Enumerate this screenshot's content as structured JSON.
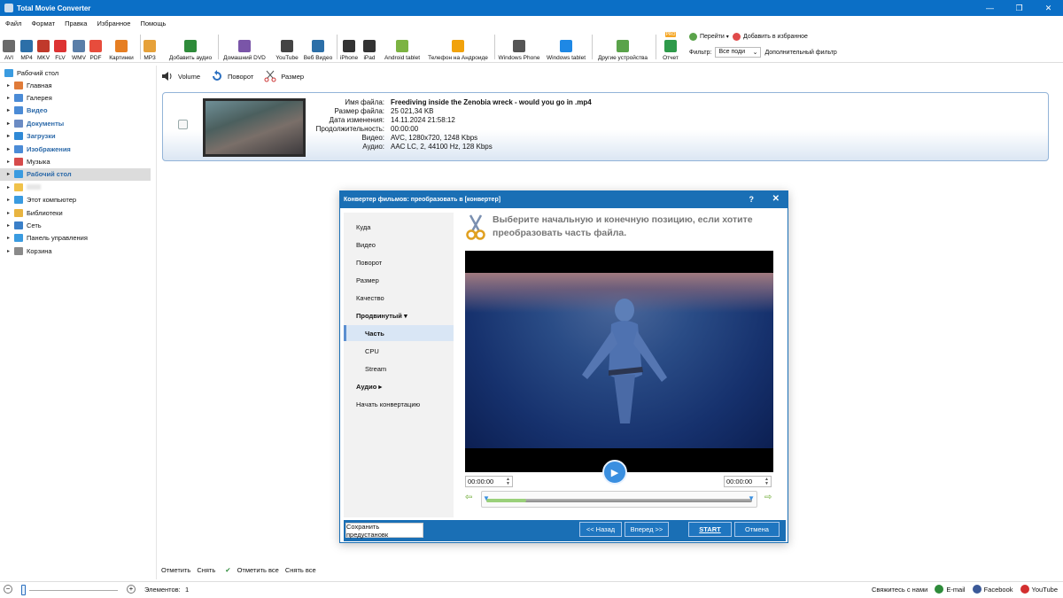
{
  "window": {
    "title": "Total Movie Converter",
    "min": "—",
    "max": "❐",
    "close": "✕"
  },
  "menu": [
    "Файл",
    "Формат",
    "Правка",
    "Избранное",
    "Помощь"
  ],
  "toolbar": {
    "items": [
      {
        "label": "AVI",
        "icon": "avi-icon",
        "color": "#6a6a6a"
      },
      {
        "label": "MP4",
        "icon": "mp4-icon",
        "color": "#2c6fa8"
      },
      {
        "label": "MKV",
        "icon": "mkv-icon",
        "color": "#c0392b"
      },
      {
        "label": "FLV",
        "icon": "flv-icon",
        "color": "#d33"
      },
      {
        "label": "WMV",
        "icon": "wmv-icon",
        "color": "#5a7ea8"
      },
      {
        "label": "PDF",
        "icon": "pdf-icon",
        "color": "#e74c3c"
      },
      {
        "label": "Картинки",
        "icon": "images-icon",
        "color": "#e67e22"
      },
      {
        "label": "MP3",
        "icon": "mp3-icon",
        "color": "#e6a13a"
      },
      {
        "label": "Добавить аудио",
        "icon": "add-audio-icon",
        "color": "#2e8b3a"
      },
      {
        "label": "Домашний DVD",
        "icon": "dvd-icon",
        "color": "#7a55a8"
      },
      {
        "label": "YouTube",
        "icon": "youtube-icon",
        "color": "#444"
      },
      {
        "label": "Веб Видео",
        "icon": "web-video-icon",
        "color": "#2c6fa8"
      },
      {
        "label": "iPhone",
        "icon": "iphone-icon",
        "color": "#333"
      },
      {
        "label": "iPad",
        "icon": "ipad-icon",
        "color": "#333"
      },
      {
        "label": "Android tablet",
        "icon": "android-tablet-icon",
        "color": "#7cb342"
      },
      {
        "label": "Телефон на Андроиде",
        "icon": "android-phone-icon",
        "color": "#f1a20b"
      },
      {
        "label": "Windows Phone",
        "icon": "windows-phone-icon",
        "color": "#555"
      },
      {
        "label": "Windows tablet",
        "icon": "windows-tablet-icon",
        "color": "#1e88e5"
      },
      {
        "label": "Другие устройства",
        "icon": "other-devices-icon",
        "color": "#5aa34a"
      },
      {
        "label": "Отчет",
        "icon": "report-icon",
        "color": "#2e9a4a",
        "badge": "PRO"
      }
    ],
    "goto_label": "Перейти",
    "add_fav_label": "Добавить в избранное",
    "filter_label": "Фильтр:",
    "filter_value": "Все поди",
    "advanced_filter_label": "Дополнительный фильтр"
  },
  "sidebar": {
    "root": "Рабочий стол",
    "items": [
      {
        "label": "Главная",
        "bold": false,
        "color": "#e07b39"
      },
      {
        "label": "Галерея",
        "bold": false,
        "color": "#4b8bd6"
      },
      {
        "label": "Видео",
        "bold": true,
        "color": "#4b8bd6"
      },
      {
        "label": "Документы",
        "bold": true,
        "color": "#6c8cc4"
      },
      {
        "label": "Загрузки",
        "bold": true,
        "color": "#2f89d6"
      },
      {
        "label": "Изображения",
        "bold": true,
        "color": "#4b8bd6"
      },
      {
        "label": "Музыка",
        "bold": false,
        "color": "#d64b4b"
      },
      {
        "label": "Рабочий стол",
        "bold": true,
        "selected": true,
        "color": "#3a9be0"
      },
      {
        "label": "",
        "bold": false,
        "color": "#f0c24a"
      },
      {
        "label": "Этот компьютер",
        "bold": false,
        "color": "#3a9be0"
      },
      {
        "label": "Библиотеки",
        "bold": false,
        "color": "#e8b440"
      },
      {
        "label": "Сеть",
        "bold": false,
        "color": "#3a7fc8"
      },
      {
        "label": "Панель управления",
        "bold": false,
        "color": "#3a9be0"
      },
      {
        "label": "Корзина",
        "bold": false,
        "color": "#8a8a8a"
      }
    ]
  },
  "actions": {
    "volume": "Volume",
    "rotate": "Поворот",
    "resize": "Размер"
  },
  "file": {
    "labels": {
      "name": "Имя файла:",
      "size": "Размер файла:",
      "modified": "Дата изменения:",
      "duration": "Продолжительность:",
      "video": "Видео:",
      "audio": "Аудио:"
    },
    "name": "Freediving inside the Zenobia wreck - would you go in  .mp4",
    "size": "25 021,34 KB",
    "modified": "14.11.2024 21:58:12",
    "duration": "00:00:00",
    "video": "AVC, 1280x720, 1248 Kbps",
    "audio": "AAC LC, 2, 44100 Hz, 128 Kbps"
  },
  "dialog": {
    "title": "Конвертер фильмов: преобразовать в [конвертер]",
    "help": "?",
    "close": "✕",
    "nav": [
      {
        "label": "Куда",
        "type": "normal"
      },
      {
        "label": "Видео",
        "type": "normal"
      },
      {
        "label": "Поворот",
        "type": "normal"
      },
      {
        "label": "Размер",
        "type": "normal"
      },
      {
        "label": "Качество",
        "type": "normal"
      },
      {
        "label": "Продвинутый ▾",
        "type": "bold"
      },
      {
        "label": "Часть",
        "type": "active"
      },
      {
        "label": "CPU",
        "type": "sub"
      },
      {
        "label": "Stream",
        "type": "sub"
      },
      {
        "label": "Аудио ▸",
        "type": "bold"
      },
      {
        "label": "Начать конвертацию",
        "type": "normal"
      }
    ],
    "hint": "Выберите начальную и конечную позицию, если хотите преобразовать часть файла.",
    "start_time": "00:00:00",
    "end_time": "00:00:00",
    "played_fraction": 0.15,
    "buttons": {
      "save_preset": "Сохранить предустановк",
      "back": "<< Назад",
      "next": "Вперед >>",
      "start": "START",
      "cancel": "Отмена"
    }
  },
  "bottom_links": {
    "check": "Отметить",
    "uncheck": "Снять",
    "check_all": "Отметить все",
    "uncheck_all": "Снять все"
  },
  "status": {
    "items_label": "Элементов:",
    "items_count": "1",
    "contact": "Свяжитесь с нами",
    "email": "E-mail",
    "facebook": "Facebook",
    "youtube": "YouTube"
  }
}
